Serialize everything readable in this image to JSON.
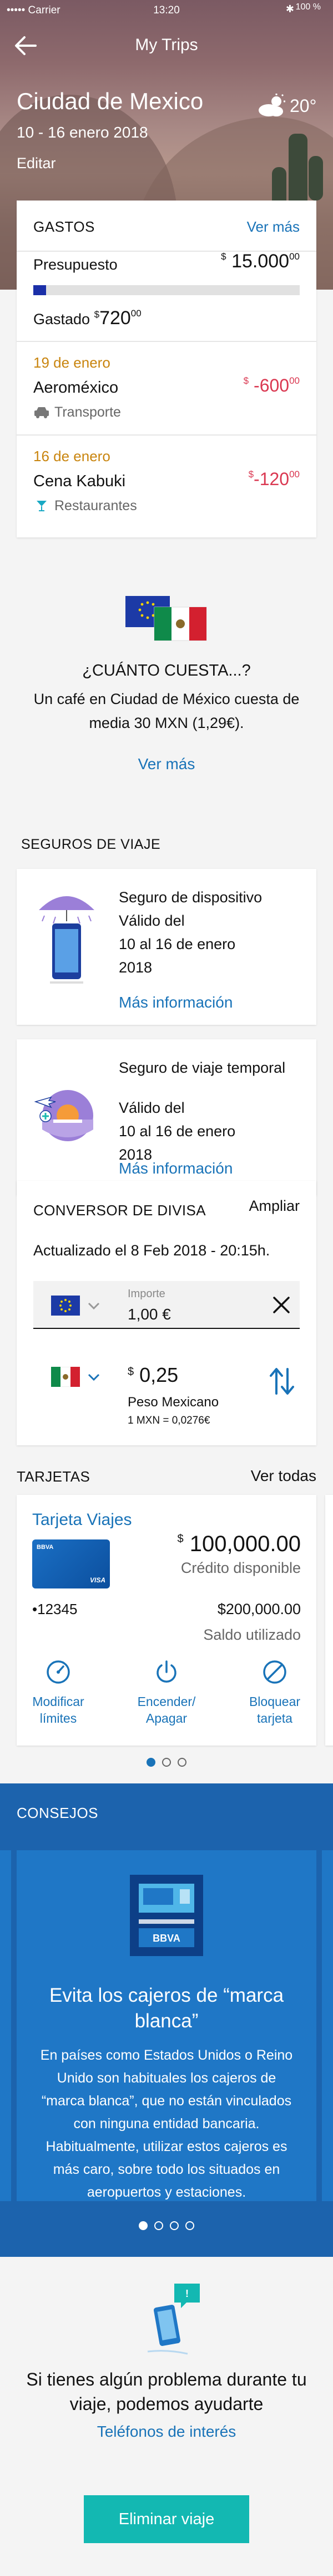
{
  "status_bar": {
    "carrier": "••••• Carrier",
    "time": "13:20",
    "battery": "100 %"
  },
  "header": {
    "title": "My Trips",
    "back_icon": "arrow-left-icon"
  },
  "trip": {
    "city": "Ciudad de Mexico",
    "dates": "10 - 16 enero 2018",
    "edit_label": "Editar",
    "temperature": "20°",
    "weather_icon": "partly-cloudy-icon"
  },
  "gastos": {
    "title": "GASTOS",
    "see_more": "Ver más",
    "budget_label": "Presupuesto",
    "budget_currency": "$",
    "budget_value": "15.000",
    "budget_cents": "00",
    "spent_label": "Gastado",
    "spent_currency": "$",
    "spent_value": "720",
    "spent_cents": "00",
    "spent_ratio": 0.048,
    "colors": {
      "bar": "#1b2fa8",
      "negative": "#da3851",
      "date": "#c9850f"
    },
    "transactions": [
      {
        "date": "19 de enero",
        "name": "Aeroméxico",
        "category": "Transporte",
        "icon": "car-icon",
        "currency": "$",
        "amount": "-600",
        "cents": "00"
      },
      {
        "date": "16 de enero",
        "name": "Cena Kabuki",
        "category": "Restaurantes",
        "icon": "cocktail-icon",
        "currency": "$",
        "amount": "-120",
        "cents": "00"
      }
    ]
  },
  "cost": {
    "title": "¿CUÁNTO CUESTA...?",
    "body": "Un café en Ciudad de México cuesta de media 30 MXN (1,29€).",
    "link": "Ver más"
  },
  "insurance": {
    "title": "SEGUROS DE VIAJE",
    "items": [
      {
        "name": "Seguro de dispositivo",
        "valid": "Válido del",
        "range": "10 al 16 de enero",
        "year": "2018",
        "link": "Más información",
        "icon": "phone-umbrella-icon"
      },
      {
        "name": "Seguro de viaje temporal",
        "valid": "Válido del",
        "range": "10 al 16 de enero",
        "year": "2018",
        "link": "Más información",
        "icon": "travel-icon"
      }
    ]
  },
  "converter": {
    "title": "CONVERSOR DE DIVISA",
    "expand": "Ampliar",
    "updated": "Actualizado el 8 Feb 2018 - 20:15h.",
    "input_label": "Importe",
    "input_value": "1,00 €",
    "result_currency": "$",
    "result_value": "0,25",
    "result_name": "Peso Mexicano",
    "rate": "1 MXN = 0,0276€"
  },
  "cards": {
    "title": "TARJETAS",
    "see_all": "Ver todas",
    "card_name": "Tarjeta Viajes",
    "card_brand": "BBVA",
    "card_network": "VISA",
    "card_number": "•12345",
    "credit_currency": "$",
    "credit_value": "100,000.00",
    "credit_label": "Crédito disponible",
    "used_value": "$200,000.00",
    "used_label": "Saldo utilizado",
    "actions": [
      {
        "line1": "Modificar",
        "line2": "límites",
        "icon": "gauge-icon"
      },
      {
        "line1": "Encender/",
        "line2": "Apagar",
        "icon": "power-icon"
      },
      {
        "line1": "Bloquear",
        "line2": "tarjeta",
        "icon": "block-icon"
      }
    ]
  },
  "tips": {
    "title": "CONSEJOS",
    "heading": "Evita los cajeros de “marca blanca”",
    "body": "En países como Estados Unidos o Reino Unido son habituales los cajeros de “marca blanca”, que no están vinculados con ninguna entidad bancaria. Habitualmente, utilizar estos cajeros es más caro, sobre todo los situados en aeropuertos y estaciones.",
    "atm_label": "BBVA"
  },
  "help": {
    "text": "Si tienes algún problema durante tu viaje, podemos ayudarte",
    "link": "Teléfonos de interés",
    "delete_button": "Eliminar viaje"
  }
}
